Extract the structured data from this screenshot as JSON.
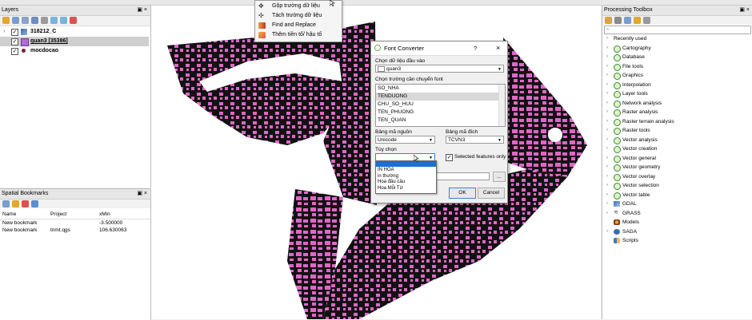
{
  "layers_panel": {
    "title": "Layers",
    "items": [
      {
        "label": "318212_C"
      },
      {
        "label": "quan3 [35386]"
      },
      {
        "label": "mocdocao"
      }
    ]
  },
  "bookmarks_panel": {
    "title": "Spatial Bookmarks",
    "columns": [
      "Name",
      "Project",
      "xMin"
    ],
    "rows": [
      {
        "name": "New bookmark",
        "project": "",
        "xmin": "-3.500000"
      },
      {
        "name": "New bookmark",
        "project": "tnmt.qgs",
        "xmin": "106.630063"
      }
    ]
  },
  "context_menu": {
    "items": [
      {
        "label": "Gộp trường dữ liệu",
        "icon": "merge-fields-icon"
      },
      {
        "label": "Tách trường dữ liệu",
        "icon": "split-fields-icon"
      },
      {
        "label": "Find and Replace",
        "icon": "find-replace-icon"
      },
      {
        "label": "Thêm tiền tố/ hậu tố",
        "icon": "prefix-suffix-icon"
      }
    ]
  },
  "font_converter": {
    "title": "Font Converter",
    "help": "?",
    "close": "×",
    "input_label": "Chọn dữ liệu đầu vào",
    "input_value": "quan3",
    "fields_label": "Chọn trường cần chuyển font",
    "fields": [
      "SO_NHA",
      "TENDUONG",
      "CHU_SO_HUU",
      "TEN_PHUONG",
      "TEN_QUAN"
    ],
    "source_label": "Bảng mã nguồn",
    "source_value": "Unicode",
    "target_label": "Bảng mã đích",
    "target_value": "TCVN3",
    "option_label": "Tùy chọn",
    "option_value": "",
    "selected_only_label": "Selected features only",
    "option_list": [
      "IN HOA",
      "in thường",
      "Hoa đầu câu",
      "Hoa Mỗi Từ"
    ],
    "browse": "...",
    "ok": "OK",
    "cancel": "Cancel"
  },
  "processing_toolbox": {
    "title": "Processing Toolbox",
    "items": [
      {
        "label": "Recently used",
        "kind": "recent"
      },
      {
        "label": "Cartography",
        "kind": "q"
      },
      {
        "label": "Database",
        "kind": "q"
      },
      {
        "label": "File tools",
        "kind": "q"
      },
      {
        "label": "Graphics",
        "kind": "q"
      },
      {
        "label": "Interpolation",
        "kind": "q"
      },
      {
        "label": "Layer tools",
        "kind": "q"
      },
      {
        "label": "Network analysis",
        "kind": "q"
      },
      {
        "label": "Raster analysis",
        "kind": "q"
      },
      {
        "label": "Raster terrain analysis",
        "kind": "q"
      },
      {
        "label": "Raster tools",
        "kind": "q"
      },
      {
        "label": "Vector analysis",
        "kind": "q"
      },
      {
        "label": "Vector creation",
        "kind": "q"
      },
      {
        "label": "Vector general",
        "kind": "q"
      },
      {
        "label": "Vector geometry",
        "kind": "q"
      },
      {
        "label": "Vector overlay",
        "kind": "q"
      },
      {
        "label": "Vector selection",
        "kind": "q"
      },
      {
        "label": "Vector table",
        "kind": "q"
      },
      {
        "label": "GDAL",
        "kind": "gdal"
      },
      {
        "label": "GRASS",
        "kind": "grass"
      },
      {
        "label": "Models",
        "kind": "models"
      },
      {
        "label": "SAGA",
        "kind": "saga"
      },
      {
        "label": "Scripts",
        "kind": "scripts"
      }
    ]
  },
  "colors": {
    "parcel_fill": "#e066c8",
    "map_dark": "#121212",
    "highlight": "#cde3f7"
  }
}
